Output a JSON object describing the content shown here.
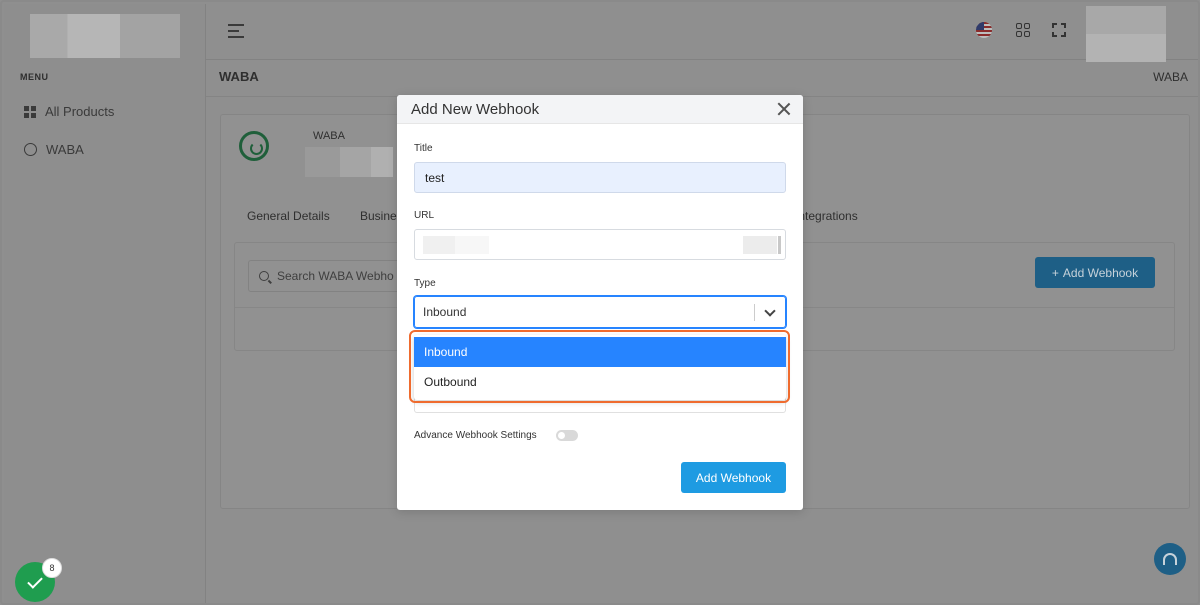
{
  "sidebar": {
    "menu_label": "MENU",
    "items": [
      {
        "label": "All Products",
        "icon": "grid-icon"
      },
      {
        "label": "WABA",
        "icon": "whatsapp-icon"
      }
    ]
  },
  "header": {
    "icons": [
      "menu-icon",
      "us-flag-icon",
      "apps-icon",
      "fullscreen-icon"
    ]
  },
  "page": {
    "title": "WABA",
    "breadcrumb": "WABA"
  },
  "waba": {
    "name": "WABA"
  },
  "tabs": [
    {
      "label": "General Details"
    },
    {
      "label": "Busines"
    },
    {
      "label": "Integrations"
    }
  ],
  "panel": {
    "search_placeholder": "Search WABA Webho",
    "add_button": "Add Webhook"
  },
  "modal": {
    "title": "Add New Webhook",
    "title_label": "Title",
    "title_value": "test",
    "url_label": "URL",
    "type_label": "Type",
    "type_value": "Inbound",
    "options": [
      "Inbound",
      "Outbound"
    ],
    "advance_label": "Advance Webhook Settings",
    "submit_label": "Add Webhook"
  },
  "badge": {
    "count": "8"
  },
  "colors": {
    "primary": "#1e9be2",
    "select_focus": "#2684ff",
    "highlight": "#ef6b2e",
    "success": "#1f9d4f"
  }
}
